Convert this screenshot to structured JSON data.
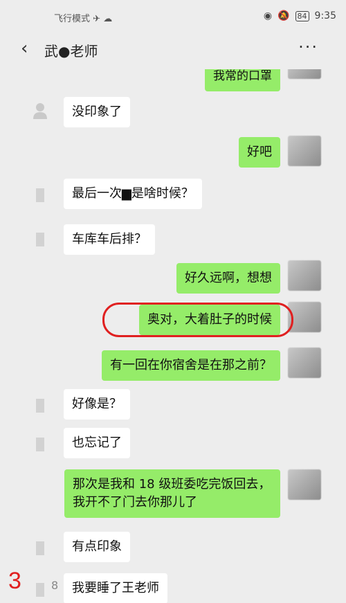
{
  "status": {
    "airplane": "飞行模式",
    "battery": "84",
    "time": "9:35"
  },
  "nav": {
    "back_icon": "chevron-left",
    "title": "武●老师",
    "more": "···"
  },
  "messages": [
    {
      "side": "right",
      "text": "我常的口罩"
    },
    {
      "side": "left",
      "text": "没印象了"
    },
    {
      "side": "right",
      "text": "好吧"
    },
    {
      "side": "left",
      "text": "最后一次▆是啥时候？"
    },
    {
      "side": "left",
      "text": "车库车后排？"
    },
    {
      "side": "right",
      "text": "好久远啊，想想"
    },
    {
      "side": "right",
      "text": "奥对，大着肚子的时候"
    },
    {
      "side": "right",
      "text": "有一回在你宿舍是在那之前？"
    },
    {
      "side": "left",
      "text": "好像是？"
    },
    {
      "side": "left",
      "text": "也忘记了"
    },
    {
      "side": "right",
      "text": "那次是我和 18 级班委吃完饭回去，我开不了门去你那儿了"
    },
    {
      "side": "left",
      "text": "有点印象"
    },
    {
      "side": "left",
      "text": "我要睡了王老师"
    }
  ],
  "annotations": {
    "red_number": "3",
    "small_number": "8"
  },
  "colors": {
    "background": "#ededed",
    "bubble_self": "#95ec69",
    "bubble_other": "#ffffff",
    "highlight": "#e02020"
  }
}
